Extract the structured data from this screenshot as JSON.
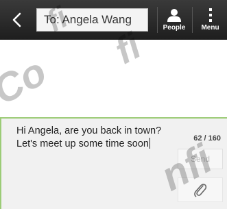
{
  "header": {
    "back_icon": "chevron-left-icon",
    "to_field_value": "To: Angela Wang",
    "people_label": "People",
    "menu_label": "Menu"
  },
  "compose": {
    "message_lines": [
      "Hi Angela, are you back in town?",
      "Let's meet up some time soon"
    ],
    "char_counter": "62 / 160",
    "send_label": "Send",
    "attach_icon": "paperclip-icon"
  },
  "watermark": {
    "text": "Confidential"
  },
  "colors": {
    "topbar": "#2a2a2a",
    "compose_accent": "#9ccc77",
    "compose_bg": "#f1f1f1"
  }
}
